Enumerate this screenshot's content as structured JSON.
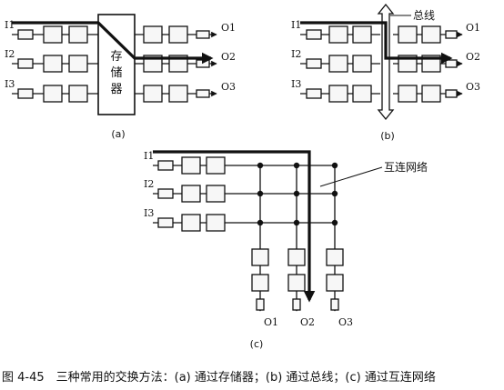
{
  "colors": {
    "ink": "#111111",
    "fill": "#f7f7f7",
    "background": "#ffffff"
  },
  "inputs": [
    "I1",
    "I2",
    "I3"
  ],
  "outputs": [
    "O1",
    "O2",
    "O3"
  ],
  "panel_a": {
    "label": "(a)",
    "memory_label": [
      "存",
      "储",
      "器"
    ]
  },
  "panel_b": {
    "label": "(b)",
    "bus_label": "总线"
  },
  "panel_c": {
    "label": "(c)",
    "interconnect_label": "互连网络"
  },
  "caption": "图 4-45　三种常用的交换方法：(a) 通过存储器；(b) 通过总线；(c) 通过互连网络"
}
